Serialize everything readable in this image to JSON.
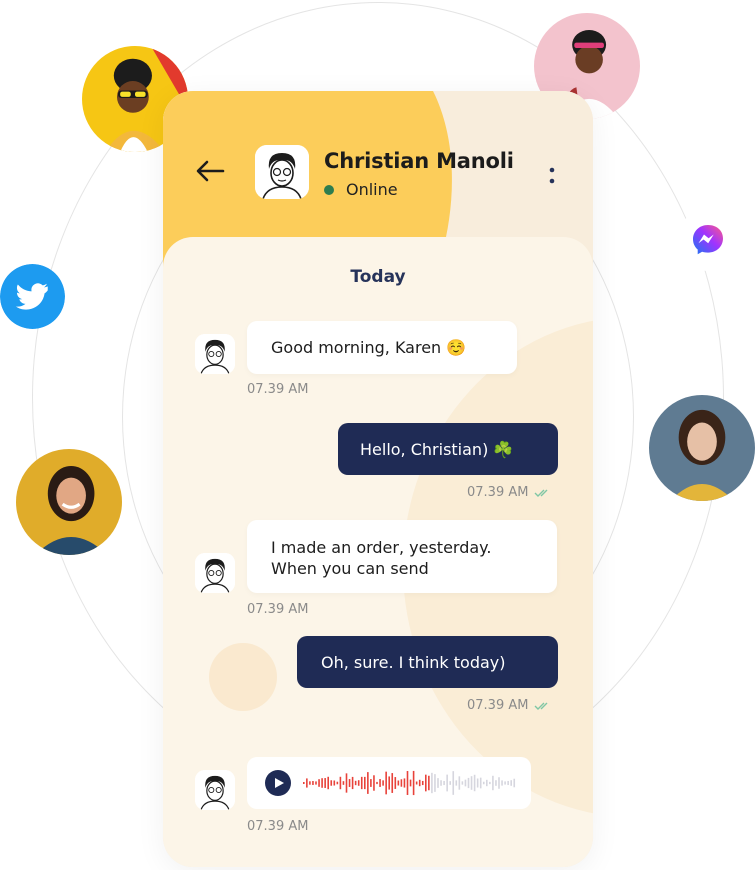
{
  "contact": {
    "name": "Christian Manoli",
    "status": "Online"
  },
  "chat": {
    "day_label": "Today",
    "messages": [
      {
        "direction": "in",
        "text": "Good morning, Karen ☺️",
        "time": "07.39 AM"
      },
      {
        "direction": "out",
        "text": "Hello, Christian) ☘️",
        "time": "07.39 AM"
      },
      {
        "direction": "in",
        "lines": [
          "I made an order, yesterday.",
          "When you can send"
        ],
        "time": "07.39 AM"
      },
      {
        "direction": "out",
        "text": "Oh, sure. I think today)",
        "time": "07.39 AM"
      },
      {
        "direction": "in",
        "type": "voice",
        "time": "07.39 AM",
        "played_fraction": 0.6
      }
    ]
  },
  "social_icons": [
    "twitter-icon",
    "messenger-icon"
  ],
  "colors": {
    "header_yellow": "#fccd5a",
    "chat_background": "#fcf5e8",
    "outgoing_bubble": "#1f2b55",
    "online_dot": "#2e7d4f",
    "waveform_played": "#e8423a",
    "waveform_unplayed": "#d6d6de",
    "twitter_blue": "#1d9bf0"
  }
}
